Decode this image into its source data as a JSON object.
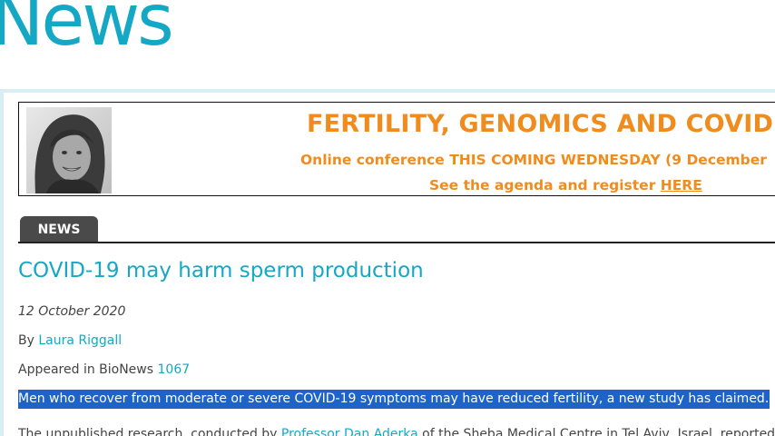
{
  "site": {
    "logo_text": "News"
  },
  "banner": {
    "title": "FERTILITY, GENOMICS AND COVID",
    "subtitle": "Online conference THIS COMING WEDNESDAY (9 December",
    "register_prefix": "See the agenda and register ",
    "register_link": "HERE"
  },
  "section_tab": "NEWS",
  "article": {
    "headline": "COVID-19 may harm sperm production",
    "date": "12 October 2020",
    "by_prefix": "By ",
    "author": "Laura Riggall",
    "appeared_prefix": "Appeared in BioNews ",
    "issue": "1067",
    "lede": "Men who recover from moderate or severe COVID-19 symptoms may have reduced fertility, a new study has claimed.",
    "para_prefix": "The unpublished research, conducted by ",
    "para_link": "Professor Dan Aderka",
    "para_suffix": " of the Sheba Medical Centre in Tel Aviv, Israel, reported"
  },
  "colors": {
    "brand": "#15a8c4",
    "banner_orange": "#f08c1e",
    "selection": "#1d63c8",
    "tab_bg": "#4a4a4a"
  }
}
